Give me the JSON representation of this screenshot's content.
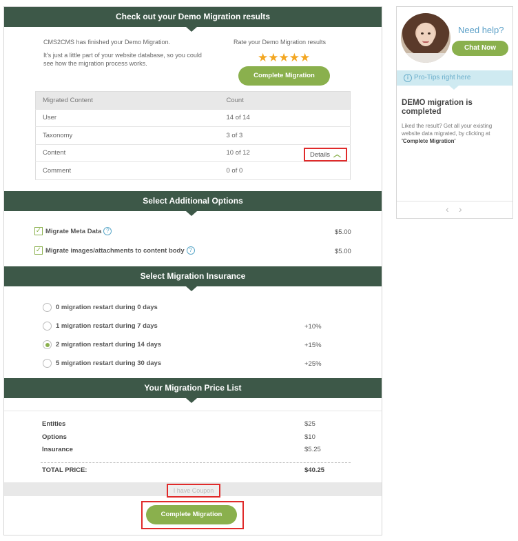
{
  "results": {
    "header": "Check out your Demo Migration results",
    "finished_text": "CMS2CMS has finished your Demo Migration.",
    "part_text": "It's just a little part of your website database, so you could see how the migration process works.",
    "rate_text": "Rate your Demo Migration results",
    "stars": "★★★★★",
    "rating": 5,
    "complete_button": "Complete Migration",
    "table": {
      "headers": [
        "Migrated Content",
        "Count"
      ],
      "rows": [
        [
          "User",
          "14 of 14"
        ],
        [
          "Taxonomy",
          "3 of 3"
        ],
        [
          "Content",
          "10 of 12"
        ],
        [
          "Comment",
          "0 of 0"
        ]
      ],
      "details_label": "Details"
    }
  },
  "options": {
    "header": "Select Additional Options",
    "items": [
      {
        "label": "Migrate Meta Data",
        "price": "$5.00",
        "checked": true
      },
      {
        "label": "Migrate images/attachments to content body",
        "price": "$5.00",
        "checked": true
      }
    ]
  },
  "insurance": {
    "header": "Select Migration Insurance",
    "items": [
      {
        "label": "0 migration restart during 0 days",
        "pct": "",
        "selected": false
      },
      {
        "label": "1 migration restart during 7 days",
        "pct": "+10%",
        "selected": false
      },
      {
        "label": "2 migration restart during 14 days",
        "pct": "+15%",
        "selected": true
      },
      {
        "label": "5 migration restart during 30 days",
        "pct": "+25%",
        "selected": false
      }
    ]
  },
  "price_list": {
    "header": "Your Migration Price List",
    "items": [
      {
        "label": "Entities",
        "value": "$25"
      },
      {
        "label": "Options",
        "value": "$10"
      },
      {
        "label": "Insurance",
        "value": "$5.25"
      }
    ],
    "total_label": "TOTAL PRICE:",
    "total_value": "$40.25",
    "coupon_label": "I have Coupon",
    "complete_button": "Complete Migration"
  },
  "sidebar": {
    "need_help": "Need help?",
    "chat_button": "Chat Now",
    "protips": "Pro-Tips right here",
    "tip_title": "DEMO migration is completed",
    "tip_body_prefix": "Liked the result? Get all your existing website data migrated, by clicking at ",
    "tip_body_bold": "'Complete Migration'",
    "prev": "‹",
    "next": "›"
  },
  "colors": {
    "header_bg": "#3d5848",
    "accent_green": "#8ab04d",
    "star": "#f3a723",
    "highlight_red": "#e02a2a",
    "info_blue": "#5a9fc7"
  }
}
